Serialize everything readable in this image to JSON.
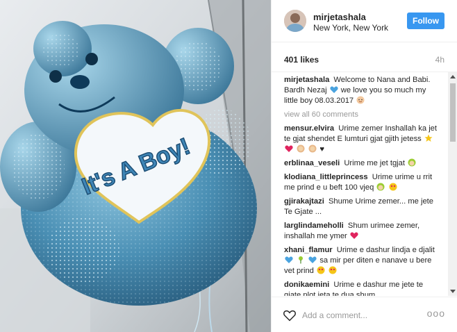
{
  "post": {
    "username": "mirjetashala",
    "location": "New York, New York",
    "follow_label": "Follow",
    "likes": "401 likes",
    "time": "4h",
    "photo_text": "It's A Boy!"
  },
  "caption": {
    "username": "mirjetashala",
    "text": "Welcome to Nana and Babi. Bardh Nezaj",
    "text_after": "we love you so much my little boy 08.03.2017"
  },
  "view_all": "view all 60 comments",
  "comments": [
    {
      "username": "mensur.elvira",
      "text": "Urime zemer Inshallah ka jet te gjat shendet E lumturi gjat gjith jetess"
    },
    {
      "username": "erblinaa_veseli",
      "text": "Urime me jet tgjat"
    },
    {
      "username": "klodiana_littleprincess",
      "text": "Urime urime u rrit me prind e u beft 100 vjeq"
    },
    {
      "username": "gjirakajtazi",
      "text": "Shume Urime zemer... me jete Te Gjate ..."
    },
    {
      "username": "larglindameholli",
      "text": "Shum urimee zemer, inshallah me ymer"
    },
    {
      "username": "xhani_flamur",
      "text": "Urime e dashur lindja e djalit",
      "text_after": "sa mir per diten e nanave u bere vet prind"
    },
    {
      "username": "donikaemini",
      "text": "Urime e dashur me jete te gjate plot jeta te dua shum"
    }
  ],
  "footer": {
    "placeholder": "Add a comment...",
    "more": "ooo"
  },
  "colors": {
    "accent": "#3897f0",
    "muted": "#999999",
    "border": "#efefef"
  },
  "icons": [
    "heart-icon",
    "more-options-icon",
    "blue-heart-emoji",
    "baby-emoji",
    "star-emoji",
    "red-heart-emoji"
  ]
}
